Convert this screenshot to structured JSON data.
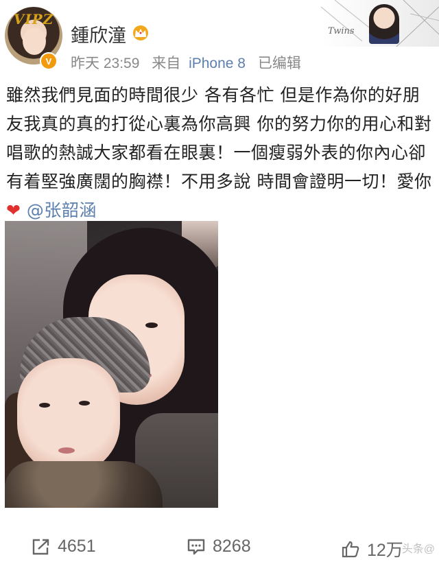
{
  "post": {
    "author": {
      "name": "鍾欣潼",
      "avatar_text": "VIPZ",
      "verified_glyph": "V",
      "badge_icon": "crown-icon"
    },
    "time": "昨天 23:59",
    "source": "来自",
    "device": "iPhone 8",
    "edited": "已编辑",
    "cover_text": "Twins",
    "text": "雖然我們見面的時間很少 各有各忙 但是作為你的好朋友我真的真的打從心裏為你高興 你的努力你的用心和對唱歌的熱誠大家都看在眼裏！一個瘦弱外表的你內心卻有着堅強廣闊的胸襟！不用多說 時間會證明一切！愛你",
    "heart": "❤",
    "mention": "@张韶涵"
  },
  "actions": {
    "share_count": "4651",
    "comment_count": "8268",
    "like_count": "12万"
  },
  "watermark": "头条@",
  "colors": {
    "link": "#5b7fae",
    "heart": "#e0312f",
    "verified": "#f29a0d",
    "crown": "#f2a81d"
  }
}
